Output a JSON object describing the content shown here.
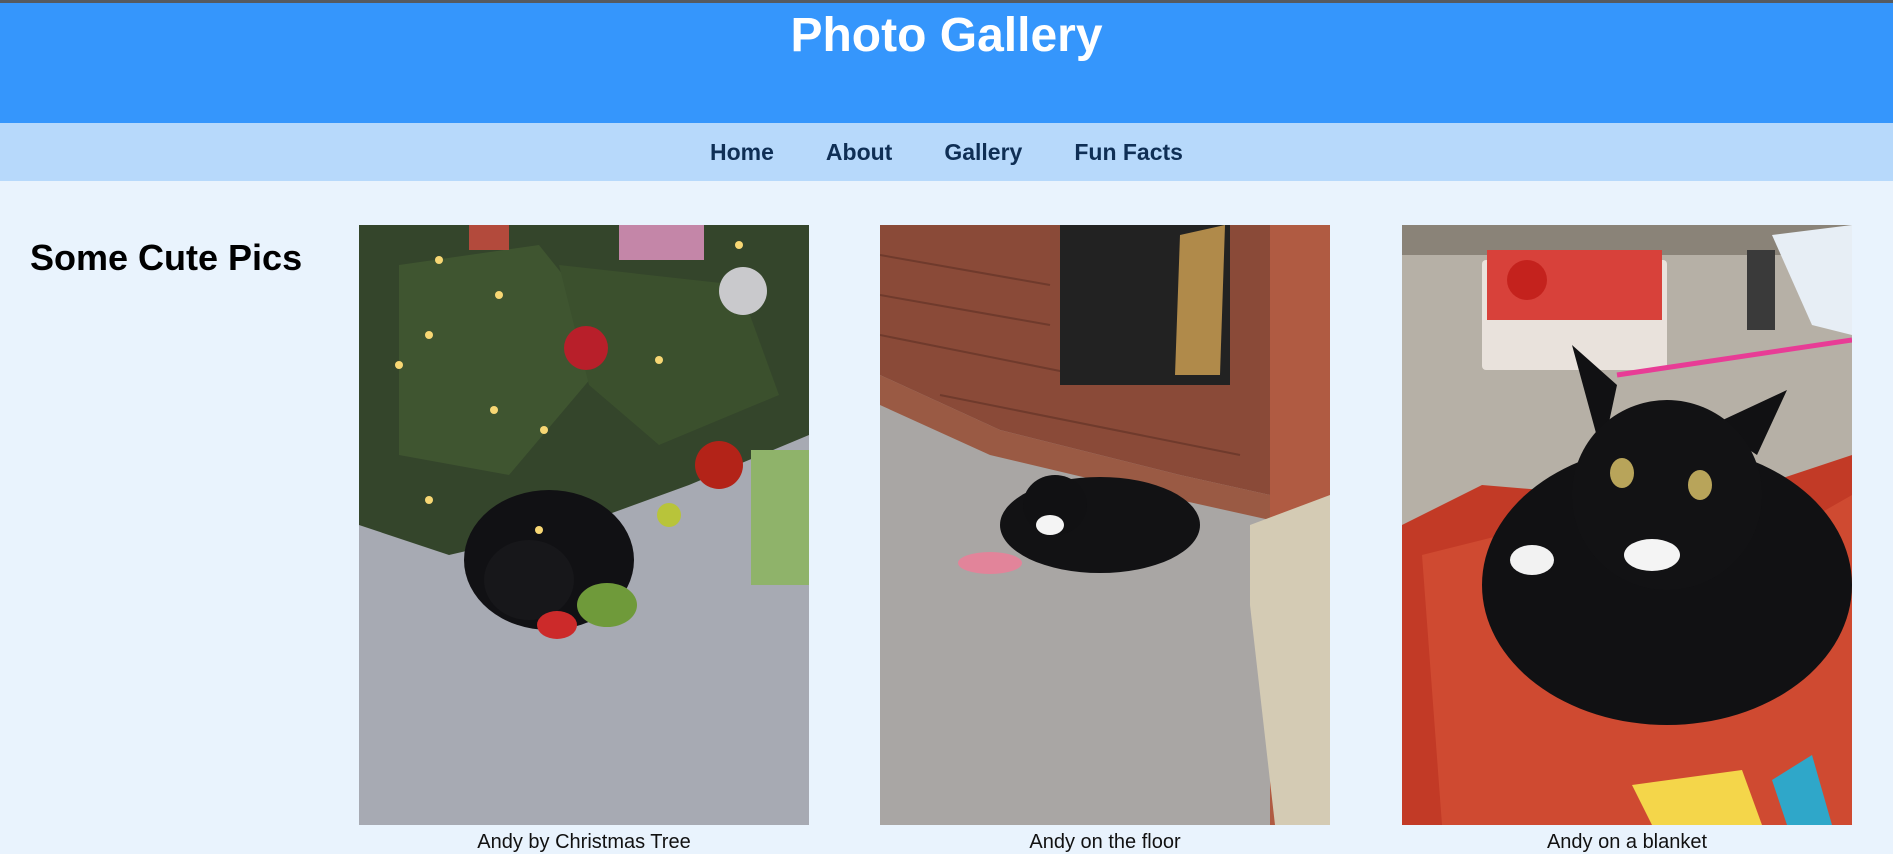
{
  "header": {
    "title": "Photo Gallery"
  },
  "nav": {
    "items": [
      "Home",
      "About",
      "Gallery",
      "Fun Facts"
    ]
  },
  "sidebar": {
    "heading": "Some Cute Pics"
  },
  "gallery": {
    "photos": [
      {
        "caption": "Andy by Christmas Tree"
      },
      {
        "caption": "Andy on the floor"
      },
      {
        "caption": "Andy on a blanket"
      }
    ]
  },
  "colors": {
    "header_bg": "#3596fc",
    "nav_bg": "#b7d9fb",
    "page_bg": "#e9f3fd",
    "nav_text": "#0f2f55"
  }
}
